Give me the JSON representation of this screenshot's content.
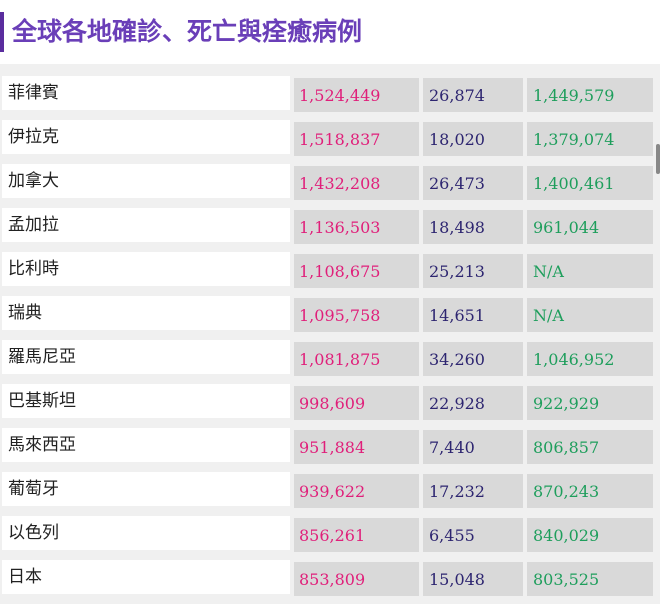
{
  "header": {
    "title": "全球各地確診、死亡與痊癒病例"
  },
  "colors": {
    "title": "#6a3fb8",
    "cases": "#e01f7a",
    "deaths": "#2d2570",
    "recovered": "#1e9e5c"
  },
  "rows": [
    {
      "name": "菲律賓",
      "cases": "1,524,449",
      "deaths": "26,874",
      "recovered": "1,449,579"
    },
    {
      "name": "伊拉克",
      "cases": "1,518,837",
      "deaths": "18,020",
      "recovered": "1,379,074"
    },
    {
      "name": "加拿大",
      "cases": "1,432,208",
      "deaths": "26,473",
      "recovered": "1,400,461"
    },
    {
      "name": "孟加拉",
      "cases": "1,136,503",
      "deaths": "18,498",
      "recovered": "961,044"
    },
    {
      "name": "比利時",
      "cases": "1,108,675",
      "deaths": "25,213",
      "recovered": "N/A"
    },
    {
      "name": "瑞典",
      "cases": "1,095,758",
      "deaths": "14,651",
      "recovered": "N/A"
    },
    {
      "name": "羅馬尼亞",
      "cases": "1,081,875",
      "deaths": "34,260",
      "recovered": "1,046,952"
    },
    {
      "name": "巴基斯坦",
      "cases": "998,609",
      "deaths": "22,928",
      "recovered": "922,929"
    },
    {
      "name": "馬來西亞",
      "cases": "951,884",
      "deaths": "7,440",
      "recovered": "806,857"
    },
    {
      "name": "葡萄牙",
      "cases": "939,622",
      "deaths": "17,232",
      "recovered": "870,243"
    },
    {
      "name": "以色列",
      "cases": "856,261",
      "deaths": "6,455",
      "recovered": "840,029"
    },
    {
      "name": "日本",
      "cases": "853,809",
      "deaths": "15,048",
      "recovered": "803,525"
    }
  ]
}
